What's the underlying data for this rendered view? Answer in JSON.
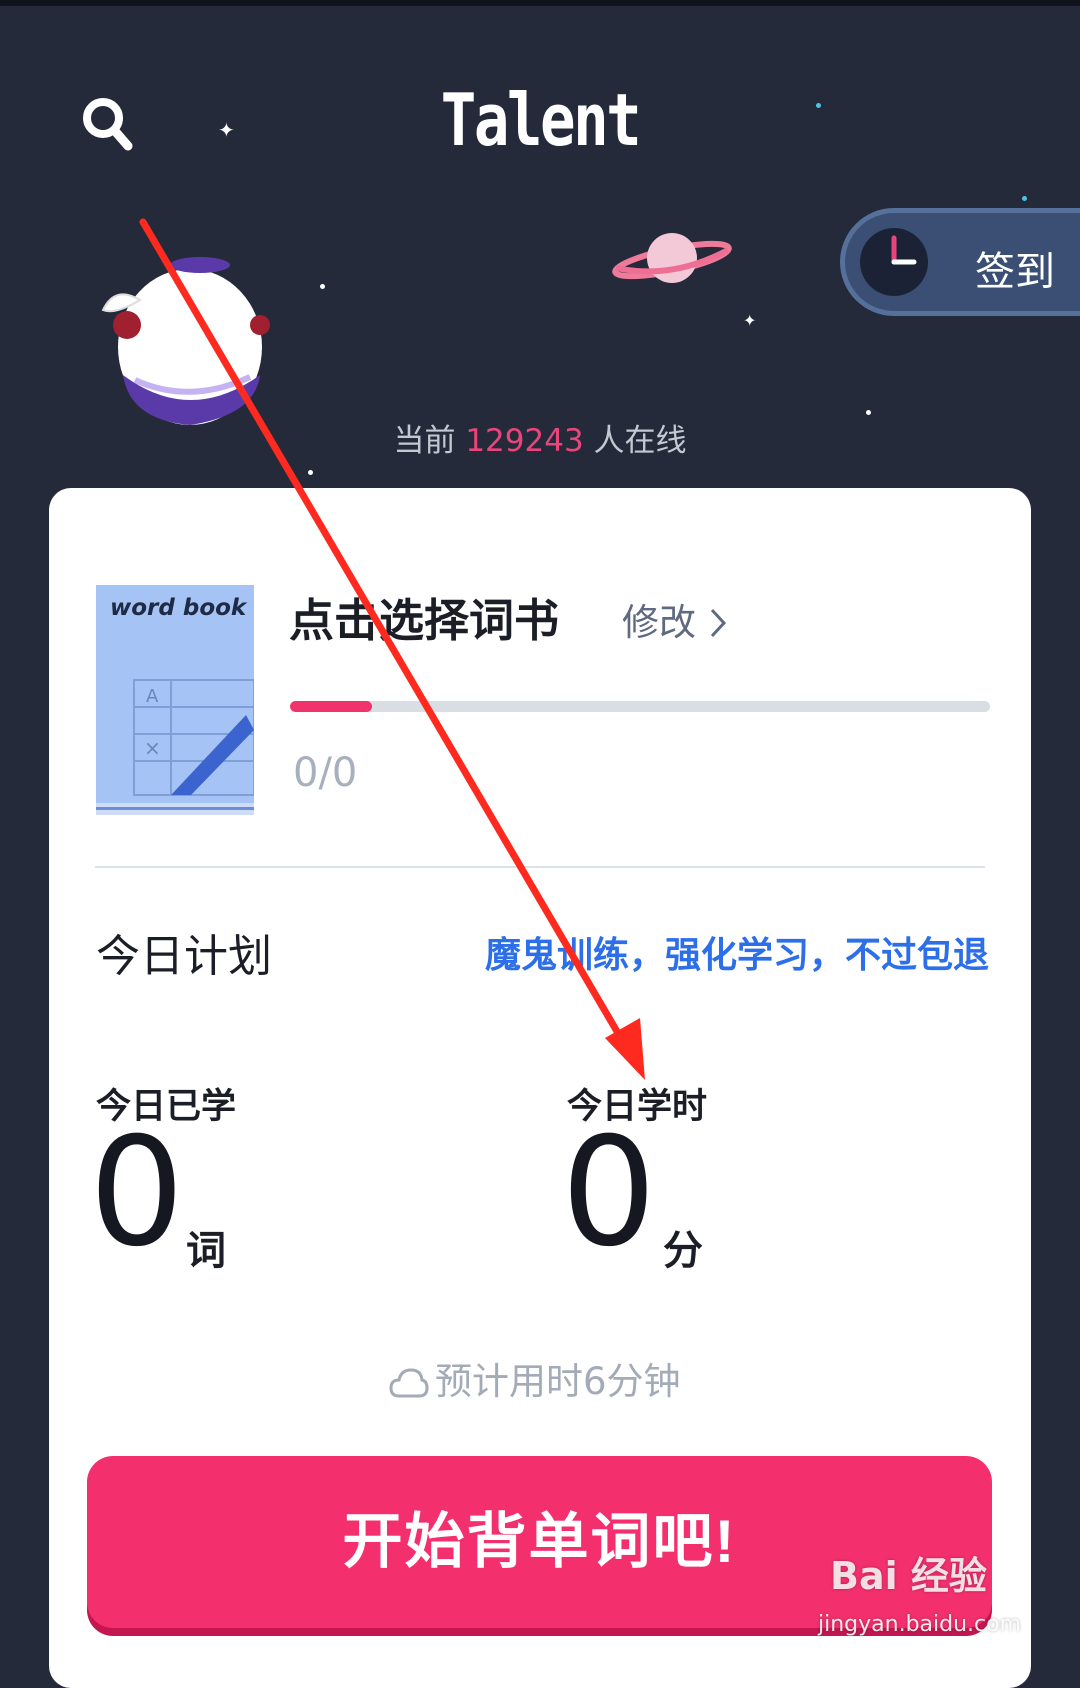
{
  "header": {
    "title": "Talent",
    "search_icon": "search-icon"
  },
  "checkin": {
    "label": "签到",
    "icon": "clock-icon"
  },
  "online": {
    "prefix": "当前",
    "count": "129243",
    "suffix": "人在线"
  },
  "wordbook": {
    "cover_title": "word book",
    "cover_row_a": "A",
    "cover_row_x": "×",
    "name": "点击选择词书",
    "modify_label": "修改",
    "progress_text": "0/0",
    "progress_fraction": 0.117
  },
  "plan": {
    "label": "今日计划",
    "promo_link": "魔鬼训练，强化学习，不过包退"
  },
  "stats": {
    "learned_label": "今日已学",
    "learned_value": "0",
    "learned_unit": "词",
    "time_label": "今日学时",
    "time_value": "0",
    "time_unit": "分"
  },
  "estimate": {
    "text": "预计用时6分钟",
    "icon": "cloud-icon"
  },
  "start_button": {
    "label": "开始背单词吧!"
  },
  "watermark": {
    "brand": "Bai 经验",
    "url": "jingyan.baidu.com"
  },
  "colors": {
    "background": "#252a3a",
    "accent_pink": "#f3306d",
    "link_blue": "#2d6fe8",
    "checkin_bg": "#3b4f74",
    "annotation_red": "#ff2a1f"
  }
}
